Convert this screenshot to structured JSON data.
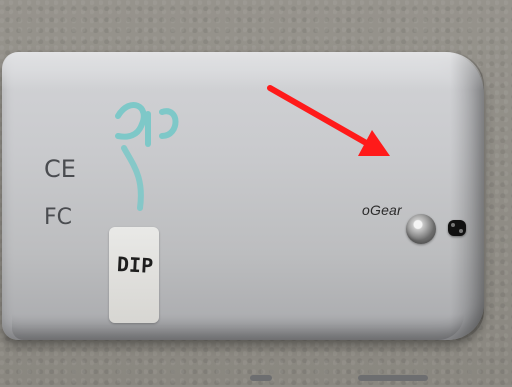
{
  "scribble": {
    "handwriting_text": "DIP"
  },
  "label": {
    "text": "DIP"
  },
  "certifications": {
    "ce": "CE",
    "fc": "FC"
  },
  "brand": {
    "text": "oGear"
  },
  "colors": {
    "arrow": "#ff1a1a",
    "scribble": "#7ec8c8",
    "device_metal": "#c9cacd",
    "carpet": "#8f8c86"
  }
}
